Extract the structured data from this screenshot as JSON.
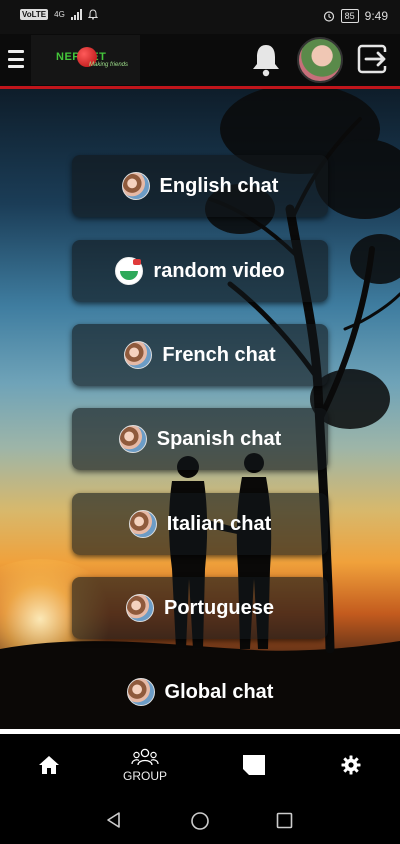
{
  "status_bar": {
    "volte": "VoLTE",
    "network": "4G",
    "battery": "85",
    "time": "9:49"
  },
  "app_bar": {
    "logo_text": "NEP  EET",
    "logo_tagline": "Making friends"
  },
  "chats": [
    {
      "label": "English chat",
      "icon": "couple-avatar-icon"
    },
    {
      "label": "random video",
      "icon": "random-video-logo-icon"
    },
    {
      "label": "French chat",
      "icon": "couple-avatar-icon"
    },
    {
      "label": "Spanish chat",
      "icon": "couple-avatar-icon"
    },
    {
      "label": "Italian chat",
      "icon": "couple-avatar-icon"
    },
    {
      "label": "Portuguese",
      "icon": "couple-avatar-icon"
    },
    {
      "label": "Global chat",
      "icon": "couple-avatar-icon"
    }
  ],
  "bottom_nav": {
    "group_label": "GROUP"
  },
  "colors": {
    "accent": "#c0151b",
    "logo_green": "#44c53a",
    "button_bg": "rgba(18,22,26,0.62)"
  }
}
